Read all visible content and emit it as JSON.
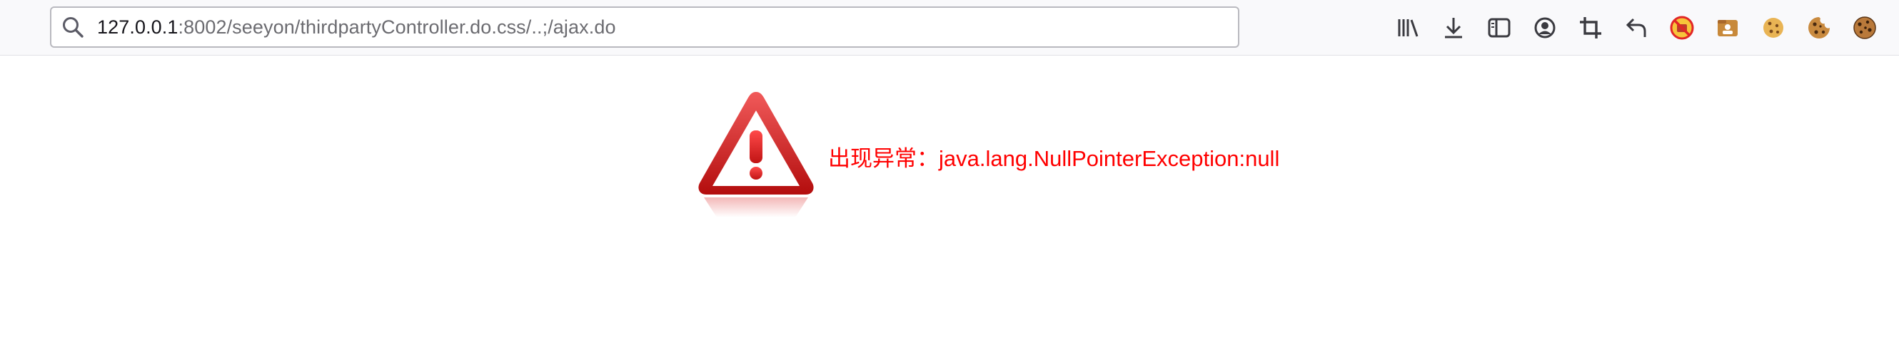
{
  "browser": {
    "url_host": "127.0.0.1",
    "url_rest": ":8002/seeyon/thirdpartyController.do.css/..;/ajax.do",
    "toolbar_icons": [
      "library-icon",
      "download-icon",
      "sidebar-icon",
      "account-icon",
      "screenshot-crop-icon",
      "back-arrow-icon",
      "blocked-extension-icon",
      "extension-folder-icon",
      "cookie-icon",
      "cookie-editor-icon",
      "cookie-manager-icon"
    ]
  },
  "page": {
    "error_message": "出现异常：java.lang.NullPointerException:null",
    "icon": "warning-triangle-icon"
  },
  "colors": {
    "error_text": "#ff0000",
    "toolbar_bg": "#f9f9fb",
    "url_host_text": "#15141a",
    "url_rest_text": "#6b6b70"
  }
}
